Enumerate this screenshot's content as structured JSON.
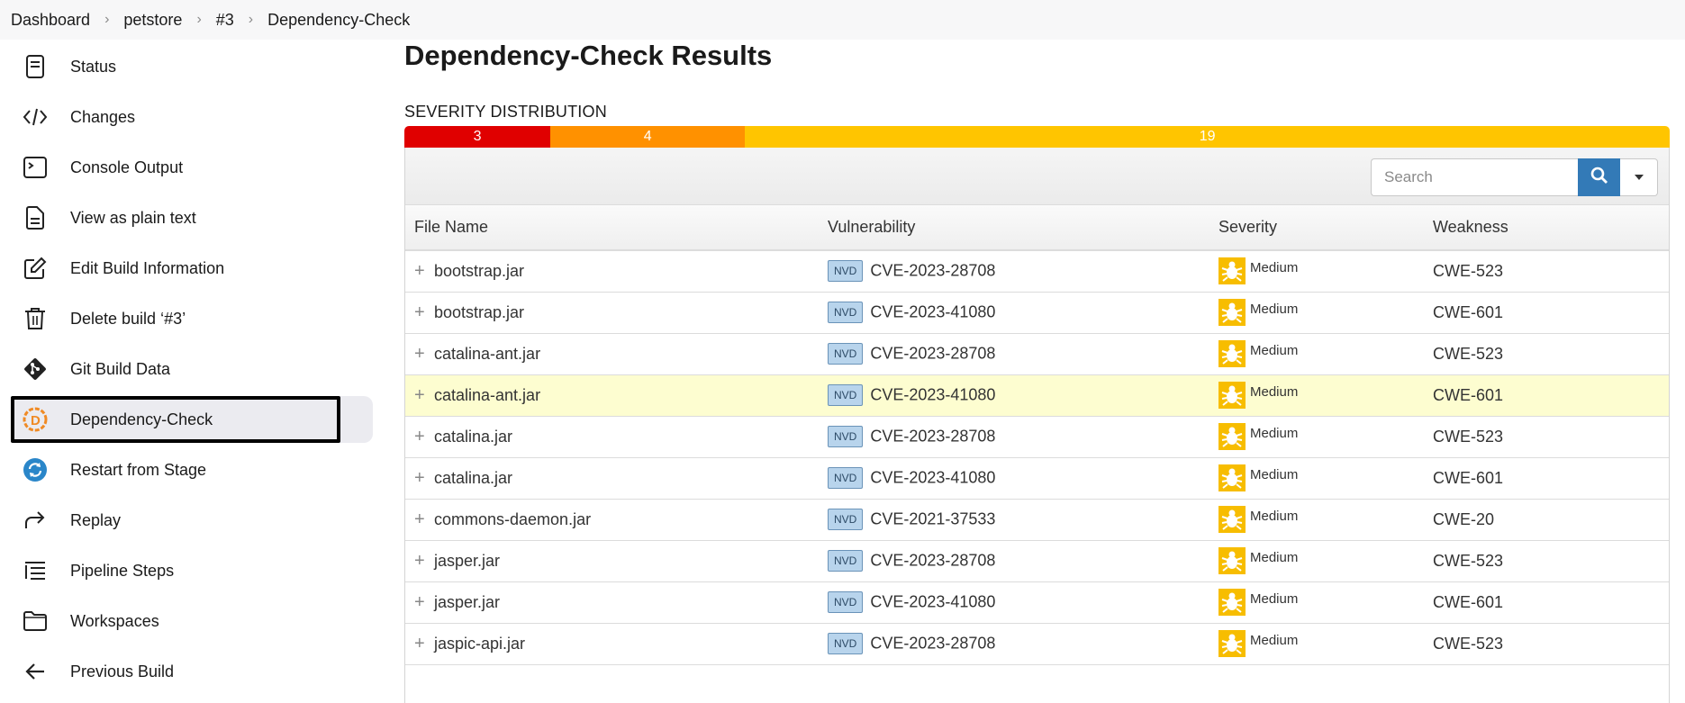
{
  "breadcrumb": {
    "items": [
      "Dashboard",
      "petstore",
      "#3",
      "Dependency-Check"
    ]
  },
  "sidebar": {
    "items": [
      {
        "label": "Status",
        "icon": "document-icon"
      },
      {
        "label": "Changes",
        "icon": "code-icon"
      },
      {
        "label": "Console Output",
        "icon": "terminal-icon"
      },
      {
        "label": "View as plain text",
        "icon": "text-file-icon"
      },
      {
        "label": "Edit Build Information",
        "icon": "edit-icon"
      },
      {
        "label": "Delete build ‘#3’",
        "icon": "trash-icon"
      },
      {
        "label": "Git Build Data",
        "icon": "git-icon"
      },
      {
        "label": "Dependency-Check",
        "icon": "dependency-check-icon",
        "active": true
      },
      {
        "label": "Restart from Stage",
        "icon": "restart-icon"
      },
      {
        "label": "Replay",
        "icon": "replay-icon"
      },
      {
        "label": "Pipeline Steps",
        "icon": "pipeline-steps-icon"
      },
      {
        "label": "Workspaces",
        "icon": "folder-icon"
      },
      {
        "label": "Previous Build",
        "icon": "arrow-left-icon"
      }
    ]
  },
  "main": {
    "title": "Dependency-Check Results",
    "severity_heading": "SEVERITY DISTRIBUTION",
    "severity_distribution": [
      {
        "count": "3",
        "color": "#e00000"
      },
      {
        "count": "4",
        "color": "#ff9100"
      },
      {
        "count": "19",
        "color": "#ffc500"
      }
    ],
    "search": {
      "placeholder": "Search"
    },
    "table": {
      "columns": [
        "File Name",
        "Vulnerability",
        "Severity",
        "Weakness"
      ],
      "rows": [
        {
          "file": "bootstrap.jar",
          "source": "NVD",
          "cve": "CVE-2023-28708",
          "severity": "Medium",
          "weakness": "CWE-523"
        },
        {
          "file": "bootstrap.jar",
          "source": "NVD",
          "cve": "CVE-2023-41080",
          "severity": "Medium",
          "weakness": "CWE-601"
        },
        {
          "file": "catalina-ant.jar",
          "source": "NVD",
          "cve": "CVE-2023-28708",
          "severity": "Medium",
          "weakness": "CWE-523"
        },
        {
          "file": "catalina-ant.jar",
          "source": "NVD",
          "cve": "CVE-2023-41080",
          "severity": "Medium",
          "weakness": "CWE-601",
          "highlight": true
        },
        {
          "file": "catalina.jar",
          "source": "NVD",
          "cve": "CVE-2023-28708",
          "severity": "Medium",
          "weakness": "CWE-523"
        },
        {
          "file": "catalina.jar",
          "source": "NVD",
          "cve": "CVE-2023-41080",
          "severity": "Medium",
          "weakness": "CWE-601"
        },
        {
          "file": "commons-daemon.jar",
          "source": "NVD",
          "cve": "CVE-2021-37533",
          "severity": "Medium",
          "weakness": "CWE-20"
        },
        {
          "file": "jasper.jar",
          "source": "NVD",
          "cve": "CVE-2023-28708",
          "severity": "Medium",
          "weakness": "CWE-523"
        },
        {
          "file": "jasper.jar",
          "source": "NVD",
          "cve": "CVE-2023-41080",
          "severity": "Medium",
          "weakness": "CWE-601"
        },
        {
          "file": "jaspic-api.jar",
          "source": "NVD",
          "cve": "CVE-2023-28708",
          "severity": "Medium",
          "weakness": "CWE-523"
        }
      ]
    }
  },
  "colors": {
    "accent": "#337ab7",
    "medium_severity": "#f7bd00",
    "highlight_row": "#fdfdd0"
  }
}
